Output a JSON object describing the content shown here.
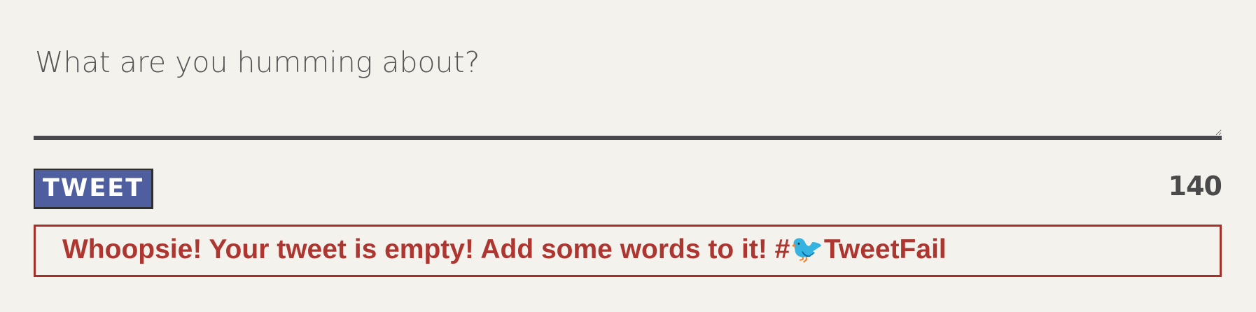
{
  "composer": {
    "placeholder": "What are you humming about?",
    "value": "",
    "tweet_button_label": "TWEET",
    "char_count": "140"
  },
  "error": {
    "message": "Whoopsie! Your tweet is empty! Add some words to it! #🐦TweetFail"
  }
}
